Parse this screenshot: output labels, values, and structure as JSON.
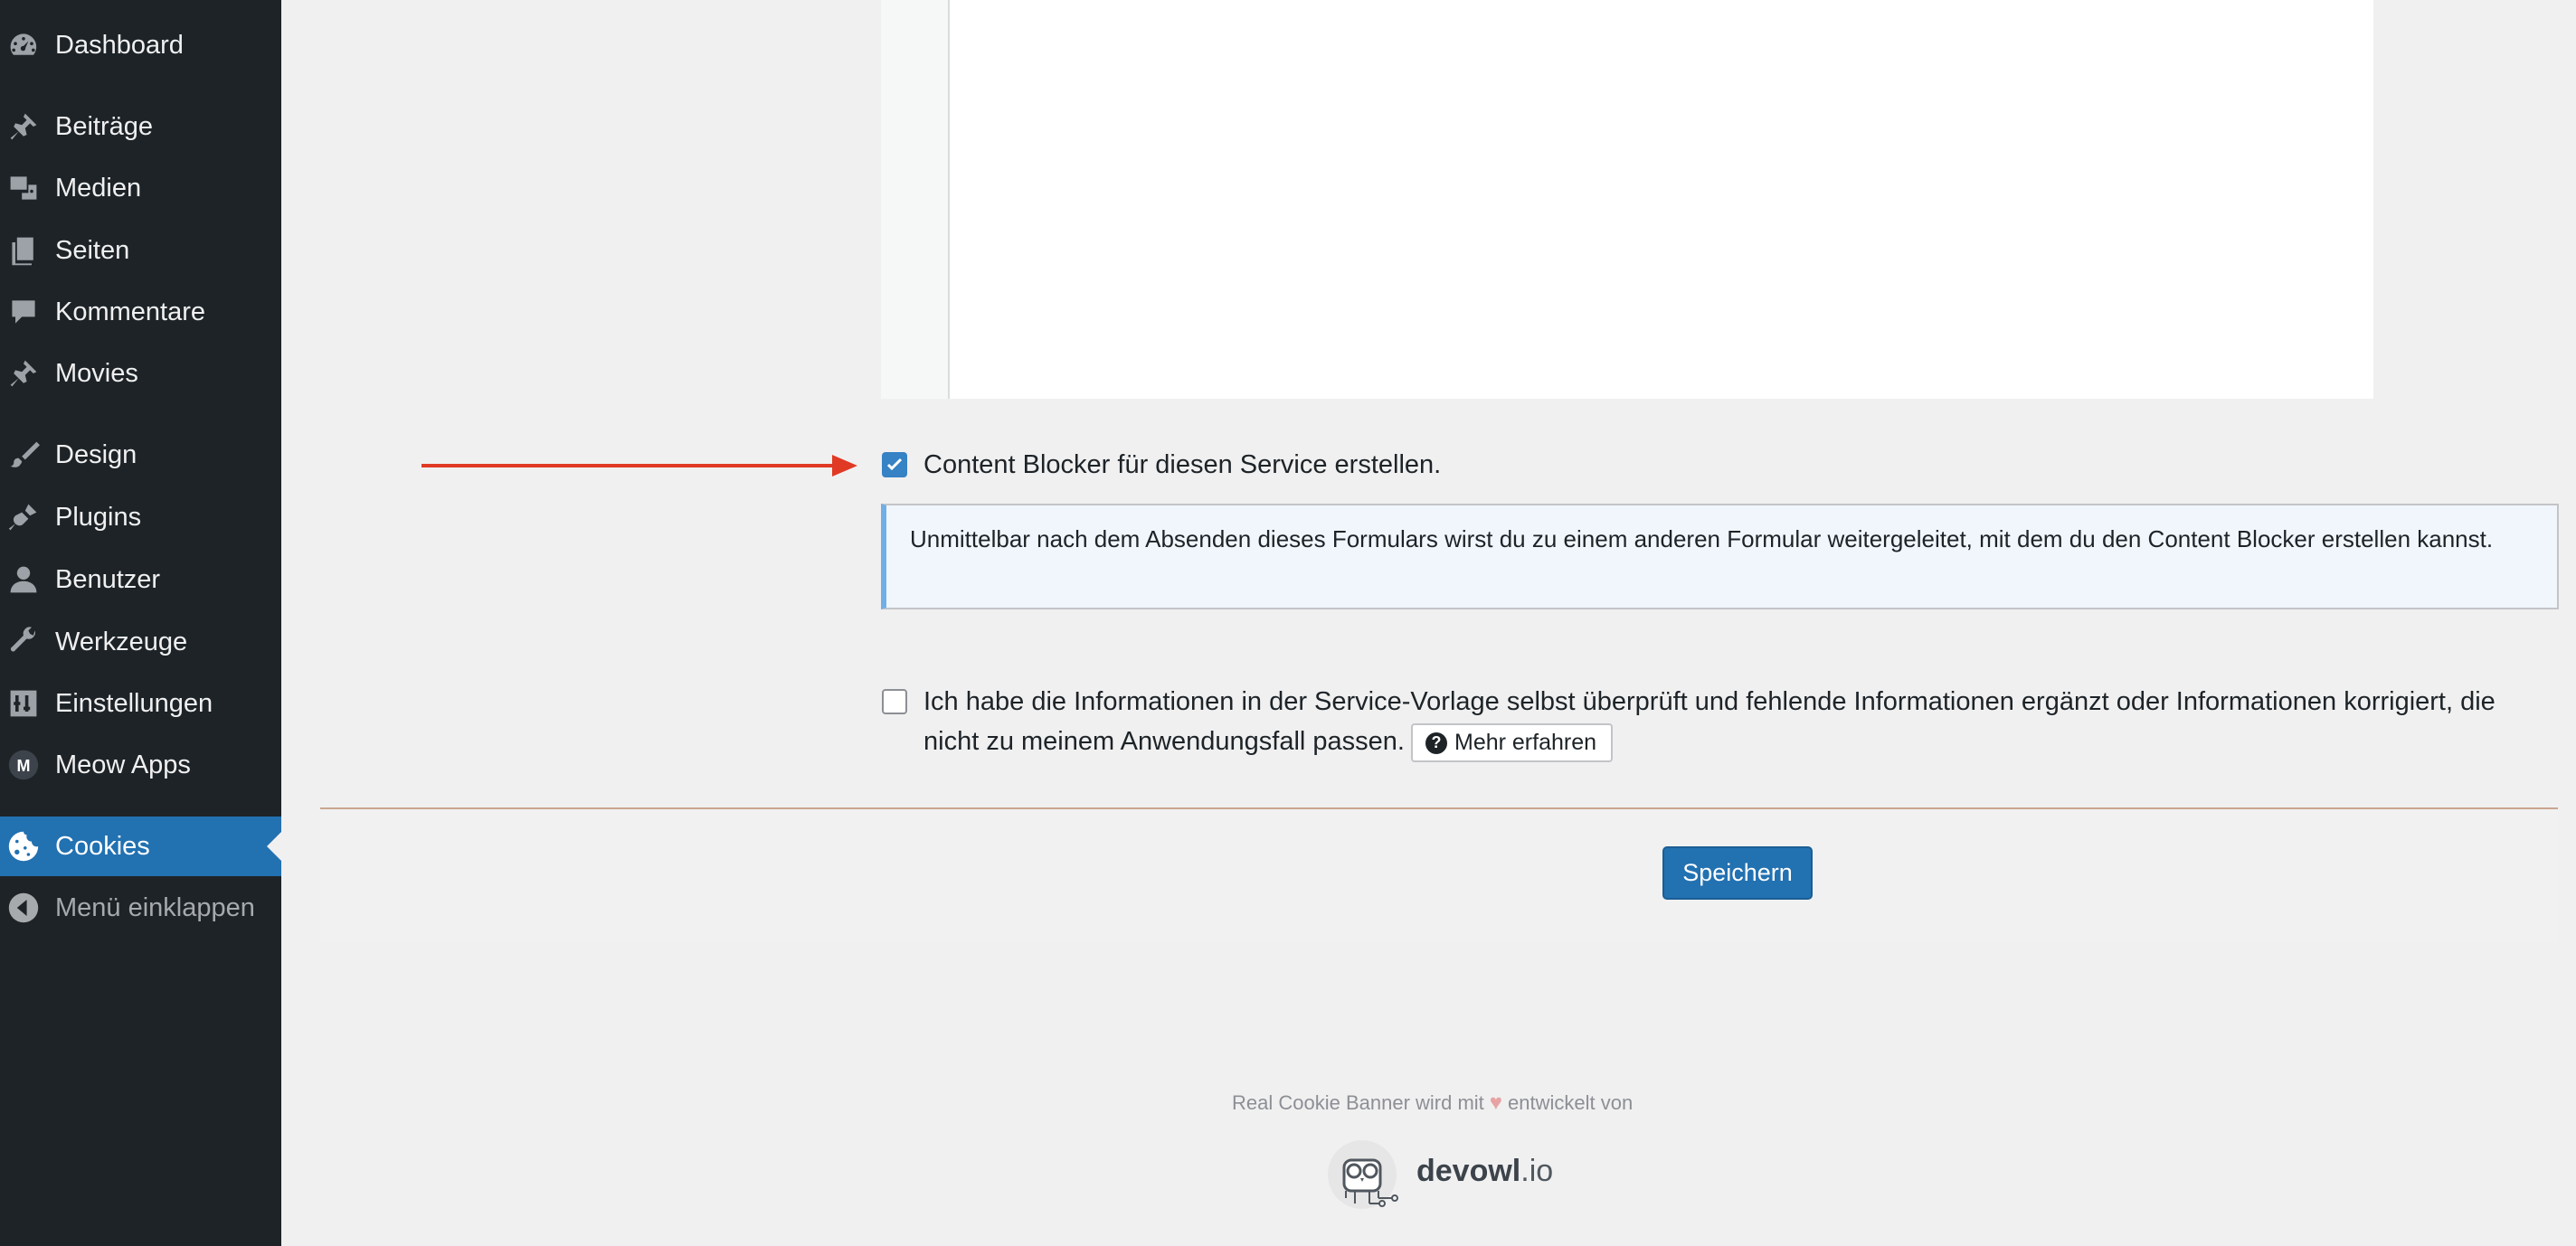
{
  "sidebar": {
    "items": [
      {
        "label": "Dashboard",
        "icon": "dashboard-icon"
      },
      {
        "label": "Beiträge",
        "icon": "pin-icon"
      },
      {
        "label": "Medien",
        "icon": "media-icon"
      },
      {
        "label": "Seiten",
        "icon": "pages-icon"
      },
      {
        "label": "Kommentare",
        "icon": "comment-icon"
      },
      {
        "label": "Movies",
        "icon": "pin-icon"
      },
      {
        "label": "Design",
        "icon": "brush-icon"
      },
      {
        "label": "Plugins",
        "icon": "plugin-icon"
      },
      {
        "label": "Benutzer",
        "icon": "user-icon"
      },
      {
        "label": "Werkzeuge",
        "icon": "wrench-icon"
      },
      {
        "label": "Einstellungen",
        "icon": "settings-icon"
      },
      {
        "label": "Meow Apps",
        "icon": "meow-apps-icon"
      },
      {
        "label": "Cookies",
        "icon": "cookie-icon",
        "active": true
      },
      {
        "label": "Menü einklappen",
        "icon": "collapse-icon"
      }
    ]
  },
  "form": {
    "content_blocker_label": "Content Blocker für diesen Service erstellen.",
    "content_blocker_checked": true,
    "notice_text": "Unmittelbar nach dem Absenden dieses Formulars wirst du zu einem anderen Formular weitergeleitet, mit dem du den Content Blocker erstellen kannst.",
    "verify_label_line1": "Ich habe die Informationen in der Service-Vorlage selbst überprüft und fehlende Informationen ergänzt oder Informationen korrigiert, die",
    "verify_label_line2": "nicht zu meinem Anwendungsfall passen.",
    "verify_checked": false,
    "more_button": "Mehr erfahren",
    "save_button": "Speichern"
  },
  "footer": {
    "credit_prefix": "Real Cookie Banner wird mit",
    "credit_suffix": "entwickelt von",
    "logo_bold": "devowl",
    "logo_rest": ".io"
  },
  "colors": {
    "sidebar_bg": "#1d2327",
    "active_bg": "#2271b1",
    "arrow": "#e03a24",
    "notice_border": "#72aee6"
  }
}
